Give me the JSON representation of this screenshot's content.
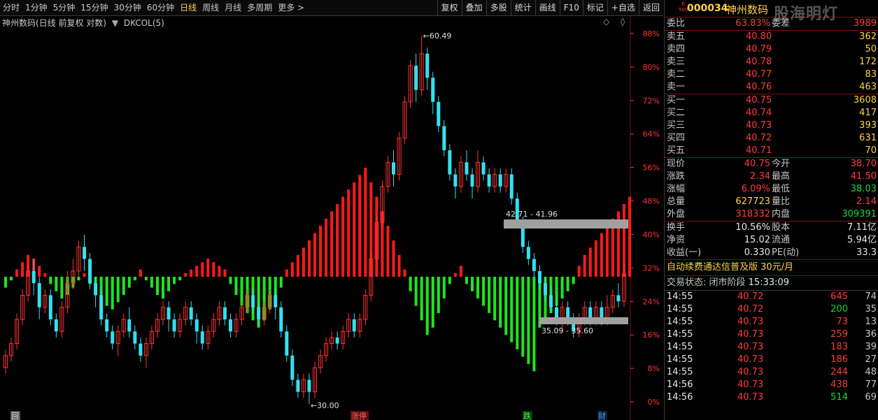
{
  "toolbar": {
    "periods": [
      "分时",
      "1分钟",
      "5分钟",
      "15分钟",
      "30分钟",
      "60分钟",
      "日线",
      "周线",
      "月线",
      "多周期",
      "更多 >"
    ],
    "selected_period": "日线",
    "buttons": [
      "复权",
      "叠加",
      "多股",
      "统计",
      "画线",
      "F10",
      "标记",
      "+自选",
      "返回"
    ]
  },
  "chart": {
    "title": "神州数码(日线 前复权 对数)",
    "indicator": "DKCOL(5)",
    "y_labels": [
      "88%",
      "80%",
      "72%",
      "64%",
      "56%",
      "48%",
      "40%",
      "32%",
      "24%",
      "16%",
      "8%",
      "0%"
    ],
    "annotation_high": "60.49",
    "annotation_low": "30.00",
    "zone_upper_label": "42.71 - 41.96",
    "zone_lower_label": "35.09 - 35.60",
    "bottom_markers": [
      "回",
      "涨停",
      "跌",
      "财"
    ],
    "colors": {
      "up": "#ff3333",
      "down": "#33e0f0",
      "bar_up": "#ff1a1a",
      "bar_down": "#1ee61e",
      "zone": "#a0a0a0",
      "axis_label": "#ff3333"
    }
  },
  "chart_data": {
    "type": "candlestick",
    "ylim": [
      30.0,
      60.49
    ],
    "high": 60.49,
    "low": 30.0,
    "candles": [
      [
        33,
        34,
        32.5,
        34.5
      ],
      [
        34,
        35,
        33.5,
        35.5
      ],
      [
        35,
        37,
        34.5,
        37.5
      ],
      [
        37,
        39,
        36.5,
        39.5
      ],
      [
        39,
        41,
        38.5,
        41.5
      ],
      [
        41,
        40,
        39,
        42
      ],
      [
        40,
        38,
        37,
        40.5
      ],
      [
        38,
        39,
        37.5,
        39.5
      ],
      [
        39,
        37,
        36.5,
        39.5
      ],
      [
        37,
        36,
        35.5,
        37.5
      ],
      [
        36,
        38,
        35.5,
        38.5
      ],
      [
        38,
        40,
        37.5,
        41
      ],
      [
        40,
        41,
        39.5,
        42
      ],
      [
        41,
        43,
        40.5,
        43.5
      ],
      [
        43,
        42,
        41,
        44
      ],
      [
        42,
        40,
        39.5,
        42.5
      ],
      [
        40,
        39,
        38,
        40.5
      ],
      [
        39,
        37,
        36.5,
        39.5
      ],
      [
        37,
        36,
        35.5,
        37.5
      ],
      [
        36,
        35,
        34.5,
        36.5
      ],
      [
        35,
        36,
        34,
        36.5
      ],
      [
        36,
        37,
        35.5,
        37.5
      ],
      [
        37,
        36,
        35.5,
        38
      ],
      [
        36,
        35,
        34.5,
        36.5
      ],
      [
        35,
        34,
        33.5,
        35.5
      ],
      [
        34,
        35,
        33,
        35.5
      ],
      [
        35,
        36,
        34.5,
        36.5
      ],
      [
        36,
        37,
        35.5,
        37.5
      ],
      [
        37,
        38,
        36.5,
        38.5
      ],
      [
        38,
        37,
        36,
        38.5
      ],
      [
        37,
        36,
        35.5,
        37.5
      ],
      [
        36,
        37,
        35.5,
        37.5
      ],
      [
        37,
        38,
        36.5,
        38.5
      ],
      [
        38,
        37,
        36.5,
        38.5
      ],
      [
        37,
        36,
        35,
        37.5
      ],
      [
        36,
        35,
        34.5,
        36.5
      ],
      [
        35,
        36,
        34.5,
        36.5
      ],
      [
        36,
        37,
        35.5,
        37.5
      ],
      [
        37,
        38,
        36.5,
        38.5
      ],
      [
        38,
        37,
        36.5,
        38.5
      ],
      [
        37,
        36,
        35.5,
        37.5
      ],
      [
        36,
        37,
        35.5,
        37.5
      ],
      [
        37,
        38,
        36.5,
        38.5
      ],
      [
        38,
        39,
        37.5,
        39.5
      ],
      [
        39,
        38,
        37.5,
        39.5
      ],
      [
        38,
        37,
        36.5,
        38.5
      ],
      [
        37,
        38,
        36.5,
        38.5
      ],
      [
        38,
        39,
        37.5,
        39.5
      ],
      [
        39,
        38,
        37,
        39.5
      ],
      [
        38,
        36,
        35.5,
        38.5
      ],
      [
        36,
        34,
        33.5,
        36.5
      ],
      [
        34,
        32,
        31.5,
        34.5
      ],
      [
        32,
        31,
        30.5,
        32.5
      ],
      [
        31,
        32,
        30.5,
        32.5
      ],
      [
        32,
        31,
        30,
        32.5
      ],
      [
        31,
        33,
        30.5,
        33.5
      ],
      [
        33,
        34,
        32.5,
        34.5
      ],
      [
        34,
        35,
        33.5,
        35.5
      ],
      [
        35,
        35.5,
        34.5,
        36
      ],
      [
        35.5,
        35,
        34.5,
        36
      ],
      [
        35,
        36,
        34.5,
        36.5
      ],
      [
        36,
        37,
        35.5,
        37.5
      ],
      [
        37,
        36,
        35.5,
        37.5
      ],
      [
        36,
        37,
        35.5,
        37.5
      ],
      [
        37,
        39,
        36.5,
        39.5
      ],
      [
        39,
        42,
        38.5,
        42.5
      ],
      [
        42,
        45,
        41.5,
        45.5
      ],
      [
        45,
        48,
        44.5,
        48.5
      ],
      [
        48,
        50,
        47.5,
        50.5
      ],
      [
        50,
        49,
        48,
        51
      ],
      [
        49,
        52,
        48.5,
        52.5
      ],
      [
        52,
        55,
        51.5,
        55.5
      ],
      [
        55,
        58,
        54.5,
        58.5
      ],
      [
        58,
        56,
        55,
        59
      ],
      [
        56,
        59,
        55.5,
        60.49
      ],
      [
        59,
        57,
        56,
        59.5
      ],
      [
        57,
        55,
        54,
        57.5
      ],
      [
        55,
        53,
        52.5,
        55.5
      ],
      [
        53,
        51,
        50.5,
        53.5
      ],
      [
        51,
        49,
        48.5,
        51.5
      ],
      [
        49,
        48,
        47,
        49.5
      ],
      [
        48,
        50,
        47.5,
        50.5
      ],
      [
        50,
        49,
        48.5,
        51
      ],
      [
        49,
        48,
        47,
        49.5
      ],
      [
        48,
        50,
        47.5,
        51
      ],
      [
        50,
        49,
        48.5,
        50.5
      ],
      [
        49,
        48,
        47.5,
        49.5
      ],
      [
        48,
        49,
        47.5,
        49.5
      ],
      [
        49,
        48,
        47.5,
        49.5
      ],
      [
        48,
        49,
        47.5,
        49.5
      ],
      [
        49,
        47,
        46.5,
        49.5
      ],
      [
        47,
        45,
        44.5,
        47.5
      ],
      [
        45,
        43,
        42.5,
        45.5
      ],
      [
        43,
        42,
        41.5,
        43.5
      ],
      [
        42,
        41,
        40.5,
        42.5
      ],
      [
        41,
        40,
        39.5,
        41.5
      ],
      [
        40,
        39,
        38.5,
        40.5
      ],
      [
        39,
        38,
        37.5,
        39.5
      ],
      [
        38,
        37,
        36.5,
        38.5
      ],
      [
        37,
        38,
        36,
        38.5
      ],
      [
        38,
        37,
        36.5,
        38.5
      ],
      [
        37,
        36,
        35.5,
        37.5
      ],
      [
        36,
        37,
        35.5,
        37.5
      ],
      [
        37,
        38,
        36.5,
        38.5
      ],
      [
        38,
        37,
        36.5,
        38.5
      ],
      [
        37,
        38,
        36.5,
        38.5
      ],
      [
        38,
        37,
        36.5,
        38.5
      ],
      [
        37,
        38,
        36.5,
        39
      ],
      [
        38,
        39,
        37.5,
        39.5
      ],
      [
        39,
        38.5,
        38,
        40
      ],
      [
        38.5,
        40.75,
        38.03,
        41.5
      ]
    ],
    "histogram": [
      -3,
      -1,
      2,
      4,
      6,
      5,
      3,
      1,
      -2,
      -4,
      -6,
      -5,
      -3,
      -1,
      1,
      -2,
      -4,
      -6,
      -8,
      -9,
      -7,
      -5,
      -3,
      -1,
      2,
      -1,
      -3,
      -5,
      -6,
      -4,
      -2,
      -1,
      1,
      2,
      3,
      4,
      5,
      4,
      3,
      2,
      -2,
      -5,
      -8,
      -10,
      -12,
      -14,
      -12,
      -9,
      -6,
      -3,
      2,
      4,
      6,
      8,
      10,
      12,
      14,
      16,
      18,
      20,
      22,
      24,
      26,
      28,
      30,
      26,
      22,
      18,
      14,
      10,
      6,
      2,
      -4,
      -8,
      -12,
      -16,
      -14,
      -10,
      -6,
      -2,
      1,
      3,
      -2,
      -4,
      -6,
      -8,
      -10,
      -12,
      -14,
      -16,
      -18,
      -20,
      -22,
      -24,
      -26,
      -14,
      -12,
      -10,
      -8,
      -6,
      -4,
      -2,
      3,
      6,
      8,
      10,
      12,
      14,
      16,
      18,
      20,
      22
    ]
  },
  "quote": {
    "badge_top": "R",
    "badge_bottom": "500",
    "code": "000034",
    "name": "神州数码",
    "watermark": "股海明灯",
    "weibi_label": "委比",
    "weibi_value": "63.83%",
    "weicha_label": "委差",
    "weicha_value": "3989",
    "asks": [
      {
        "label": "卖五",
        "price": "40.80",
        "vol": "362"
      },
      {
        "label": "卖四",
        "price": "40.79",
        "vol": "50"
      },
      {
        "label": "卖三",
        "price": "40.78",
        "vol": "172"
      },
      {
        "label": "卖二",
        "price": "40.77",
        "vol": "83"
      },
      {
        "label": "卖一",
        "price": "40.76",
        "vol": "463"
      }
    ],
    "bids": [
      {
        "label": "买一",
        "price": "40.75",
        "vol": "3608"
      },
      {
        "label": "买二",
        "price": "40.74",
        "vol": "417"
      },
      {
        "label": "买三",
        "price": "40.73",
        "vol": "393"
      },
      {
        "label": "买四",
        "price": "40.72",
        "vol": "631"
      },
      {
        "label": "买五",
        "price": "40.71",
        "vol": "70"
      }
    ],
    "stats1": [
      {
        "l1": "现价",
        "v1": "40.75",
        "c1": "red",
        "l2": "今开",
        "v2": "38.70",
        "c2": "red"
      },
      {
        "l1": "涨跌",
        "v1": "2.34",
        "c1": "red",
        "l2": "最高",
        "v2": "41.50",
        "c2": "red"
      },
      {
        "l1": "涨幅",
        "v1": "6.09%",
        "c1": "red",
        "l2": "最低",
        "v2": "38.03",
        "c2": "green"
      },
      {
        "l1": "总量",
        "v1": "627723",
        "c1": "yellow",
        "l2": "量比",
        "v2": "2.14",
        "c2": "red"
      },
      {
        "l1": "外盘",
        "v1": "318332",
        "c1": "red",
        "l2": "内盘",
        "v2": "309391",
        "c2": "green"
      }
    ],
    "stats2": [
      {
        "l1": "换手",
        "v1": "10.56%",
        "l2": "股本",
        "v2": "7.11亿"
      },
      {
        "l1": "净资",
        "v1": "15.02",
        "l2": "流通",
        "v2": "5.94亿"
      },
      {
        "l1": "收益(一)",
        "v1": "0.330",
        "l2": "PE(动)",
        "v2": "33.3"
      }
    ],
    "promo": "自动续费通达信普及版  30元/月",
    "status_label": "交易状态: 闭市阶段",
    "status_time": "15:33:09",
    "ticks": [
      {
        "t": "14:55",
        "p": "40.72",
        "v": "645",
        "c": "red",
        "n": "74"
      },
      {
        "t": "14:55",
        "p": "40.72",
        "v": "200",
        "c": "green",
        "n": "35"
      },
      {
        "t": "14:55",
        "p": "40.73",
        "v": "73",
        "c": "red",
        "n": "13"
      },
      {
        "t": "14:55",
        "p": "40.73",
        "v": "259",
        "c": "red",
        "n": "36"
      },
      {
        "t": "14:55",
        "p": "40.73",
        "v": "183",
        "c": "red",
        "n": "39"
      },
      {
        "t": "14:55",
        "p": "40.73",
        "v": "186",
        "c": "red",
        "n": "27"
      },
      {
        "t": "14:55",
        "p": "40.73",
        "v": "244",
        "c": "red",
        "n": "48"
      },
      {
        "t": "14:56",
        "p": "40.73",
        "v": "438",
        "c": "red",
        "n": "77"
      },
      {
        "t": "14:56",
        "p": "40.73",
        "v": "514",
        "c": "green",
        "n": "69"
      }
    ]
  }
}
